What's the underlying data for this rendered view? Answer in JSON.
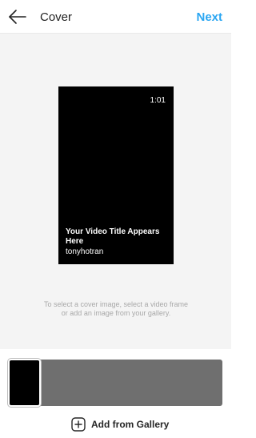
{
  "header": {
    "title": "Cover",
    "next_label": "Next",
    "back_icon": "arrow-left-icon",
    "accent_color": "#2aa6f2"
  },
  "video_preview": {
    "duration": "1:01",
    "title": "Your Video Title Appears Here",
    "username": "tonyhotran"
  },
  "instruction_text": "To select a cover image, select a video frame or add an image from your gallery.",
  "frame_strip": {
    "selected_index": 0
  },
  "gallery": {
    "label": "Add from Gallery",
    "icon": "plus-square-icon"
  }
}
